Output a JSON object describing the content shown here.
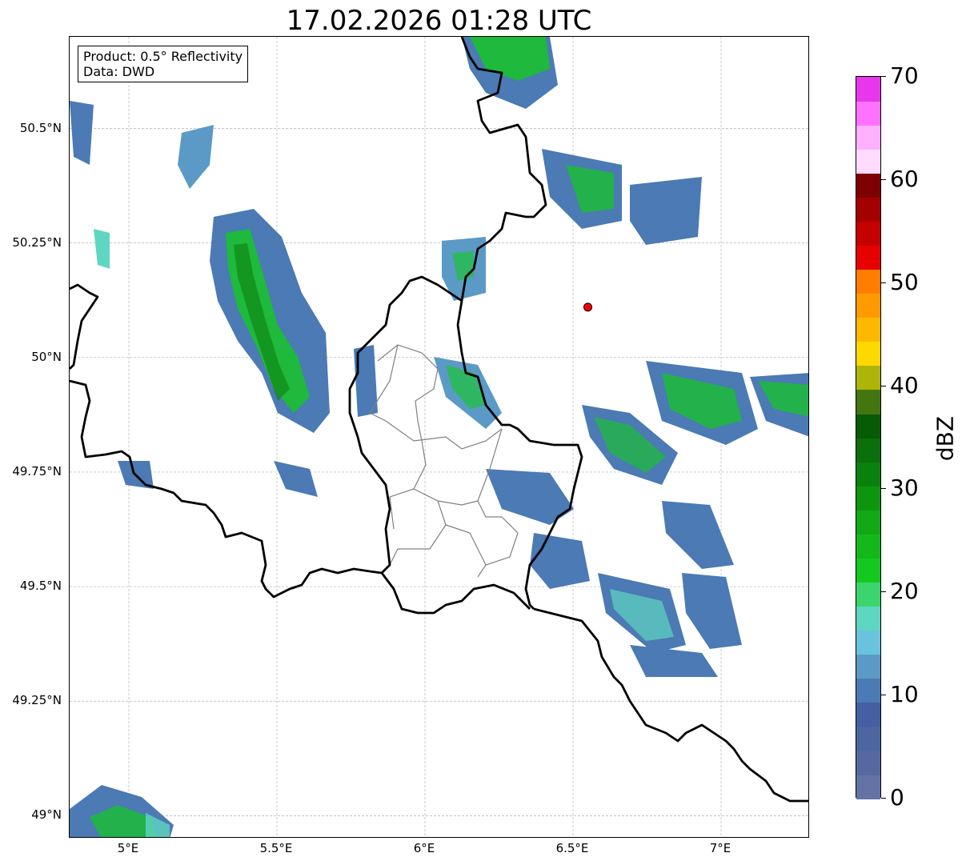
{
  "title": "17.02.2026 01:28 UTC",
  "info_box": {
    "product": "Product: 0.5° Reflectivity",
    "data": "Data: DWD"
  },
  "map": {
    "lon_range": [
      4.8,
      7.3
    ],
    "lat_range": [
      48.95,
      50.7
    ],
    "grid_lines": true,
    "x_ticks": [
      {
        "lon": 5.0,
        "label": "5°E"
      },
      {
        "lon": 5.5,
        "label": "5.5°E"
      },
      {
        "lon": 6.0,
        "label": "6°E"
      },
      {
        "lon": 6.5,
        "label": "6.5°E"
      },
      {
        "lon": 7.0,
        "label": "7°E"
      }
    ],
    "y_ticks": [
      {
        "lat": 50.5,
        "label": "50.5°N"
      },
      {
        "lat": 50.25,
        "label": "50.25°N"
      },
      {
        "lat": 50.0,
        "label": "50°N"
      },
      {
        "lat": 49.75,
        "label": "49.75°N"
      },
      {
        "lat": 49.5,
        "label": "49.5°N"
      },
      {
        "lat": 49.25,
        "label": "49.25°N"
      },
      {
        "lat": 49.0,
        "label": "49°N"
      }
    ],
    "radar_site": {
      "lon": 6.55,
      "lat": 50.11,
      "color": "#ff0000"
    },
    "colors": {
      "country_border": "#000000",
      "admin_border": "#808080",
      "grid": "#b0b0b0"
    }
  },
  "colorbar": {
    "label": "dBZ",
    "vmin": 0,
    "vmax": 70,
    "ticks": [
      {
        "value": 0,
        "label": "0"
      },
      {
        "value": 10,
        "label": "10"
      },
      {
        "value": 20,
        "label": "20"
      },
      {
        "value": 30,
        "label": "30"
      },
      {
        "value": 40,
        "label": "40"
      },
      {
        "value": 50,
        "label": "50"
      },
      {
        "value": 60,
        "label": "60"
      },
      {
        "value": 70,
        "label": "70"
      }
    ],
    "colors": [
      "#6473a6",
      "#5568a0",
      "#4d65a0",
      "#445fa2",
      "#4b7ab4",
      "#5b9ac6",
      "#69c3dc",
      "#5fd6c1",
      "#3cd46c",
      "#13c91f",
      "#14b81a",
      "#12a816",
      "#0e9510",
      "#0b810d",
      "#0b6f0b",
      "#075a06",
      "#437510",
      "#adb508",
      "#ffd800",
      "#ffb800",
      "#ff9a00",
      "#ff7d00",
      "#e60000",
      "#c40000",
      "#a40000",
      "#7e0000",
      "#ffdcff",
      "#ffb0ff",
      "#ff72ff",
      "#e737ec"
    ]
  }
}
